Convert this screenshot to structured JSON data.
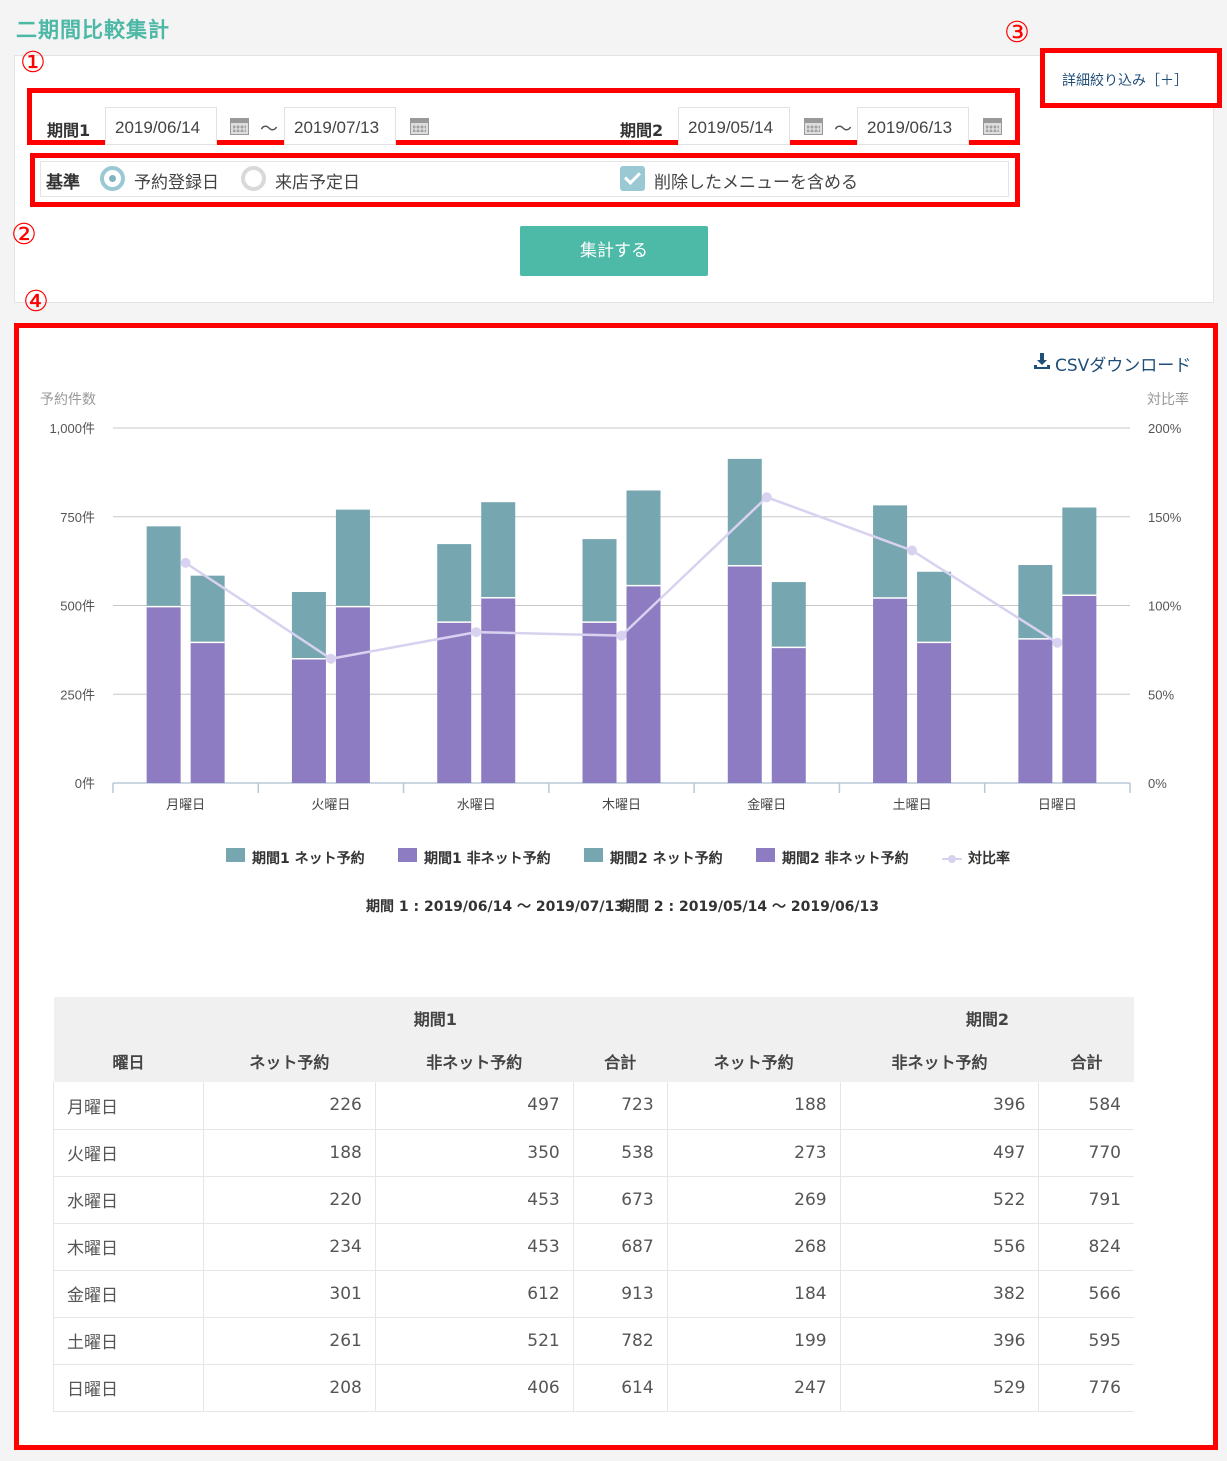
{
  "page_title": "二期間比較集計",
  "markers": [
    "①",
    "②",
    "③",
    "④"
  ],
  "filters": {
    "period1_label": "期間1",
    "period1_start": "2019/06/14",
    "period1_end": "2019/07/13",
    "period2_label": "期間2",
    "period2_start": "2019/05/14",
    "period2_end": "2019/06/13",
    "tilde": "～",
    "basis_label": "基準",
    "basis_options": [
      {
        "label": "予約登録日",
        "selected": true
      },
      {
        "label": "来店予定日",
        "selected": false
      }
    ],
    "include_deleted_label": "削除したメニューを含める",
    "include_deleted_checked": true,
    "submit_label": "集計する",
    "detail_label": "詳細絞り込み［＋］"
  },
  "result": {
    "csv_label": "CSVダウンロード",
    "caption_period1": "期間 1 : 2019/06/14 ～ 2019/07/13",
    "caption_period2": "期間 2 : 2019/05/14 ～ 2019/06/13"
  },
  "chart_data": {
    "type": "bar",
    "stacked": true,
    "categories": [
      "月曜日",
      "火曜日",
      "水曜日",
      "木曜日",
      "金曜日",
      "土曜日",
      "日曜日"
    ],
    "series": [
      {
        "name": "期間1 ネット予約",
        "group": "期間1",
        "color": "#76a6b0",
        "values": [
          226,
          188,
          220,
          234,
          301,
          261,
          208
        ]
      },
      {
        "name": "期間1 非ネット予約",
        "group": "期間1",
        "color": "#8e7cc3",
        "values": [
          497,
          350,
          453,
          453,
          612,
          521,
          406
        ]
      },
      {
        "name": "期間2 ネット予約",
        "group": "期間2",
        "color": "#76a6b0",
        "values": [
          188,
          273,
          269,
          268,
          184,
          199,
          247
        ]
      },
      {
        "name": "期間2 非ネット予約",
        "group": "期間2",
        "color": "#8e7cc3",
        "values": [
          396,
          497,
          522,
          556,
          382,
          396,
          529
        ]
      },
      {
        "name": "対比率",
        "type": "line",
        "axis": "right",
        "color": "#d8d2f0",
        "values": [
          124,
          70,
          85,
          83,
          161,
          131,
          79
        ]
      }
    ],
    "ylabel": "予約件数",
    "y2label": "対比率",
    "ylim": [
      0,
      1000
    ],
    "y2lim": [
      0,
      200
    ],
    "yticks": [
      "0件",
      "250件",
      "500件",
      "750件",
      "1,000件"
    ],
    "y2ticks": [
      "0%",
      "50%",
      "100%",
      "150%",
      "200%"
    ],
    "grid": true,
    "legend_position": "bottom"
  },
  "table": {
    "group_headers": {
      "period1": "期間1",
      "period2": "期間2"
    },
    "columns": [
      "曜日",
      "ネット予約",
      "非ネット予約",
      "合計",
      "ネット予約",
      "非ネット予約",
      "合計"
    ],
    "rows": [
      [
        "月曜日",
        "226",
        "497",
        "723",
        "188",
        "396",
        "584"
      ],
      [
        "火曜日",
        "188",
        "350",
        "538",
        "273",
        "497",
        "770"
      ],
      [
        "水曜日",
        "220",
        "453",
        "673",
        "269",
        "522",
        "791"
      ],
      [
        "木曜日",
        "234",
        "453",
        "687",
        "268",
        "556",
        "824"
      ],
      [
        "金曜日",
        "301",
        "612",
        "913",
        "184",
        "382",
        "566"
      ],
      [
        "土曜日",
        "261",
        "521",
        "782",
        "199",
        "396",
        "595"
      ],
      [
        "日曜日",
        "208",
        "406",
        "614",
        "247",
        "529",
        "776"
      ]
    ]
  }
}
